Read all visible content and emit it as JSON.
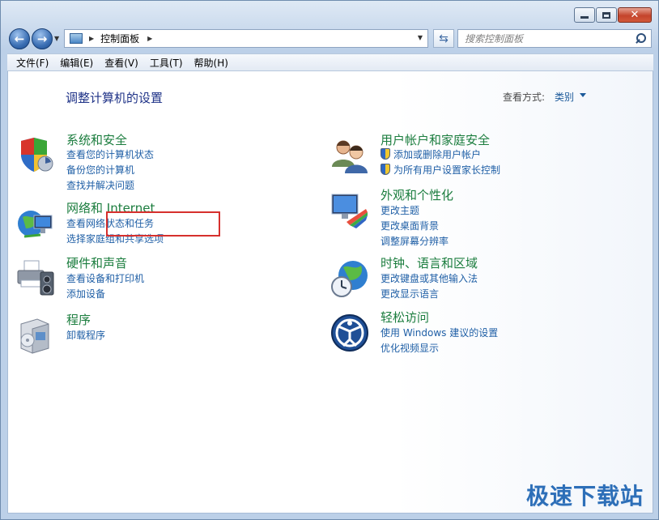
{
  "window": {
    "caption_buttons": {
      "minimize": "",
      "maximize": "",
      "close": "✕"
    }
  },
  "nav": {
    "breadcrumb": "控制面板",
    "search_placeholder": "搜索控制面板"
  },
  "menu": [
    "文件(F)",
    "编辑(E)",
    "查看(V)",
    "工具(T)",
    "帮助(H)"
  ],
  "content": {
    "title": "调整计算机的设置",
    "view_by_label": "查看方式:",
    "view_by_value": "类别",
    "left_categories": [
      {
        "title": "系统和安全",
        "links": [
          "查看您的计算机状态",
          "备份您的计算机",
          "查找并解决问题"
        ],
        "icon": "shield-icon"
      },
      {
        "title": "网络和 Internet",
        "links": [
          "查看网络状态和任务",
          "选择家庭组和共享选项"
        ],
        "icon": "network-globe-icon"
      },
      {
        "title": "硬件和声音",
        "links": [
          "查看设备和打印机",
          "添加设备"
        ],
        "icon": "printer-icon"
      },
      {
        "title": "程序",
        "links": [
          "卸载程序"
        ],
        "icon": "programs-box-icon"
      }
    ],
    "right_categories": [
      {
        "title": "用户帐户和家庭安全",
        "links": [
          "添加或删除用户帐户",
          "为所有用户设置家长控制"
        ],
        "icon": "users-icon"
      },
      {
        "title": "外观和个性化",
        "links": [
          "更改主题",
          "更改桌面背景",
          "调整屏幕分辨率"
        ],
        "icon": "monitor-palette-icon"
      },
      {
        "title": "时钟、语言和区域",
        "links": [
          "更改键盘或其他输入法",
          "更改显示语言"
        ],
        "icon": "globe-clock-icon"
      },
      {
        "title": "轻松访问",
        "links": [
          "使用 Windows 建议的设置",
          "优化视频显示"
        ],
        "icon": "ease-of-access-icon"
      }
    ]
  },
  "watermark": "极速下载站",
  "colors": {
    "category_title": "#1b7d3e",
    "link": "#1f5fa6",
    "highlight": "#d6302d"
  }
}
